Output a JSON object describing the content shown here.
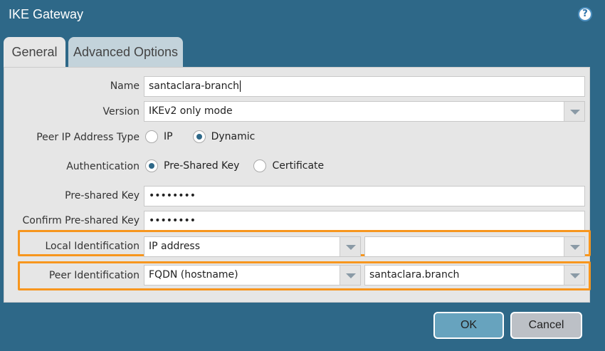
{
  "dialog": {
    "title": "IKE Gateway",
    "help_icon": "?"
  },
  "tabs": [
    {
      "label": "General"
    },
    {
      "label": "Advanced Options"
    }
  ],
  "form": {
    "name": {
      "label": "Name",
      "value": "santaclara-branch"
    },
    "version": {
      "label": "Version",
      "value": "IKEv2 only mode"
    },
    "peer_ip_type": {
      "label": "Peer IP Address Type",
      "options": [
        "IP",
        "Dynamic"
      ],
      "selected": "Dynamic"
    },
    "authentication": {
      "label": "Authentication",
      "options": [
        "Pre-Shared Key",
        "Certificate"
      ],
      "selected": "Pre-Shared Key"
    },
    "psk": {
      "label": "Pre-shared Key",
      "value": "••••••••"
    },
    "confirm_psk": {
      "label": "Confirm Pre-shared Key",
      "value": "••••••••"
    },
    "local_id": {
      "label": "Local Identification",
      "type": "IP address",
      "value": ""
    },
    "peer_id": {
      "label": "Peer Identification",
      "type": "FQDN (hostname)",
      "value": "santaclara.branch"
    }
  },
  "buttons": {
    "ok": "OK",
    "cancel": "Cancel"
  },
  "colors": {
    "highlight": "#f7961e",
    "background": "#2e6888"
  }
}
